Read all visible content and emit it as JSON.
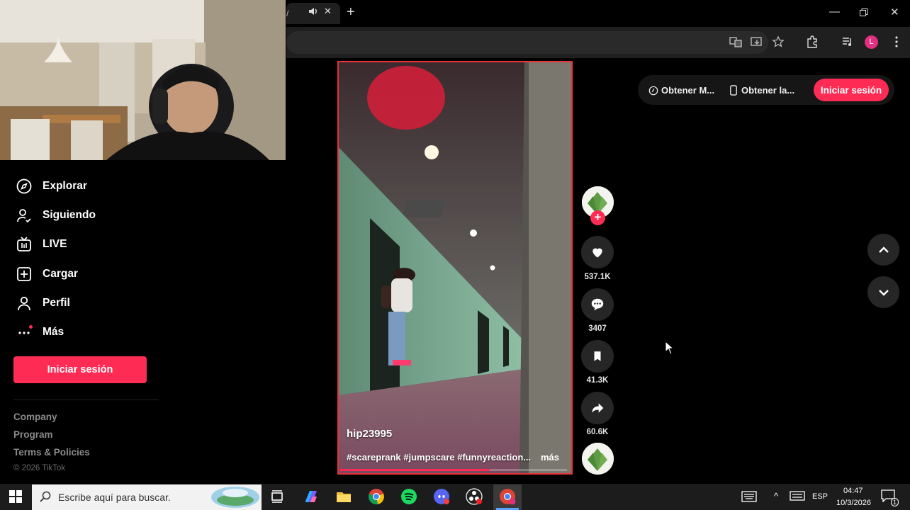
{
  "colors": {
    "brand": "#fe2c55",
    "background": "#000000",
    "button_bg": "#262626"
  },
  "sidebar": {
    "items": [
      {
        "label": "Explorar",
        "icon": "compass-icon"
      },
      {
        "label": "Siguiendo",
        "icon": "user-follow-icon"
      },
      {
        "label": "LIVE",
        "icon": "live-tv-icon"
      },
      {
        "label": "Cargar",
        "icon": "upload-plus-icon"
      },
      {
        "label": "Perfil",
        "icon": "profile-icon"
      },
      {
        "label": "Más",
        "icon": "more-dots-icon"
      }
    ],
    "login_label": "Iniciar sesión",
    "footer": [
      "Company",
      "Program",
      "Terms & Policies"
    ],
    "copyright": "© 2026 TikTok"
  },
  "header": {
    "get_app_label": "Obtener M...",
    "get_mobile_label": "Obtener la...",
    "login_label": "Iniciar sesión"
  },
  "video": {
    "username": "hip23995",
    "caption": "#scareprank #jumpscare #funnyreaction...",
    "more_label": "más",
    "progress": 0.66
  },
  "actions": {
    "likes": "537.1K",
    "comments": "3407",
    "saves": "41.3K",
    "shares": "60.6K"
  },
  "taskbar": {
    "search_placeholder": "Escribe aquí para buscar.",
    "language": "ESP",
    "time": "04:47",
    "date": "10/3/2026",
    "notification_count": "1"
  },
  "browser": {
    "profile_initial": "L"
  }
}
